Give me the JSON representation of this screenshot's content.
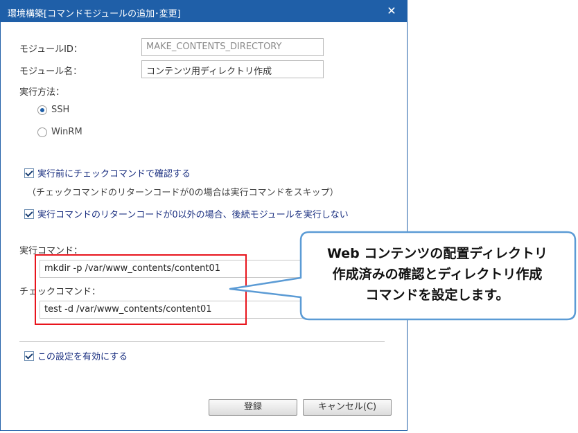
{
  "dialog": {
    "title": "環境構築[コマンドモジュールの追加･変更]",
    "close_symbol": "✕"
  },
  "form": {
    "module_id_label": "モジュールID：",
    "module_id_value": "MAKE_CONTENTS_DIRECTORY",
    "module_name_label": "モジュール名：",
    "module_name_value": "コンテンツ用ディレクトリ作成",
    "exec_method_label": "実行方法：",
    "exec_methods": [
      {
        "label": "SSH",
        "selected": true
      },
      {
        "label": "WinRM",
        "selected": false
      }
    ],
    "pre_check_label": "実行前にチェックコマンドで確認する",
    "pre_check_note": "（チェックコマンドのリターンコードが0の場合は実行コマンドをスキップ）",
    "no_continue_label": "実行コマンドのリターンコードが0以外の場合、後続モジュールを実行しない",
    "exec_command_label": "実行コマンド：",
    "exec_command_value": "mkdir -p /var/www_contents/content01",
    "check_command_label": "チェックコマンド：",
    "check_command_value": "test -d /var/www_contents/content01",
    "enable_label": "この設定を有効にする"
  },
  "buttons": {
    "register": "登録",
    "cancel": "キャンセル(C)"
  },
  "callout": {
    "lines": [
      "Web コンテンツの配置ディレクトリ",
      "作成済みの確認とディレクトリ作成",
      "コマンドを設定します。"
    ]
  },
  "colors": {
    "titlebar": "#1f5fa8",
    "highlight": "#e8141c",
    "callout_border": "#5b9bd5"
  }
}
